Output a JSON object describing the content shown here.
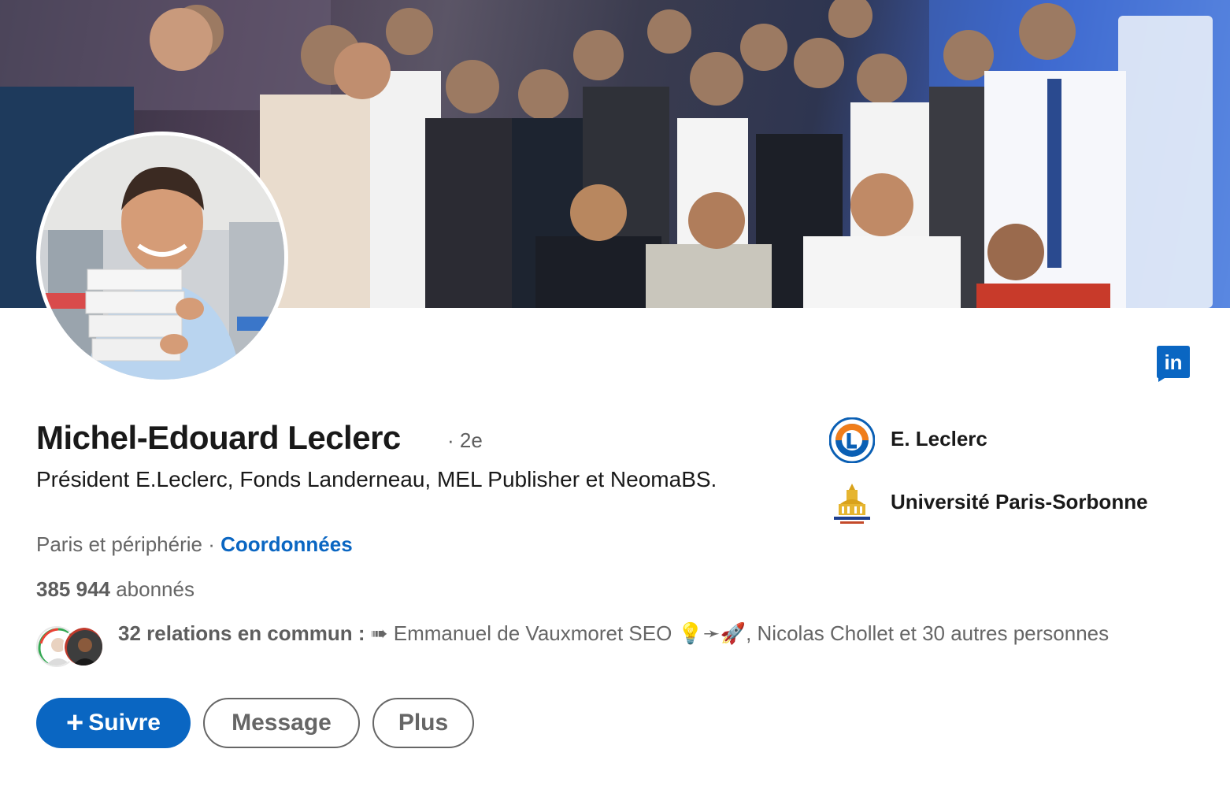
{
  "profile": {
    "name": "Michel-Edouard Leclerc",
    "degree": "· 2e",
    "headline": "Président E.Leclerc, Fonds Landerneau, MEL Publisher et NeomaBS.",
    "location": "Paris et périphérie",
    "location_separator": " · ",
    "contact_link": "Coordonnées",
    "followers_count": "385 944",
    "followers_label": " abonnés"
  },
  "mutual": {
    "count_label": "32 relations en commun :",
    "names": " ➠ Emmanuel de Vauxmoret SEO 💡➛🚀, Nicolas Chollet et 30 autres personnes"
  },
  "actions": {
    "follow_icon": "+",
    "follow_label": "Suivre",
    "message_label": "Message",
    "more_label": "Plus"
  },
  "organizations": [
    {
      "name": "E. Leclerc",
      "icon": "leclerc-logo-icon"
    },
    {
      "name": "Université Paris-Sorbonne",
      "icon": "sorbonne-logo-icon"
    }
  ],
  "brand": {
    "badge_icon": "linkedin-icon",
    "badge_text": "in",
    "accent_color": "#0a66c2"
  }
}
